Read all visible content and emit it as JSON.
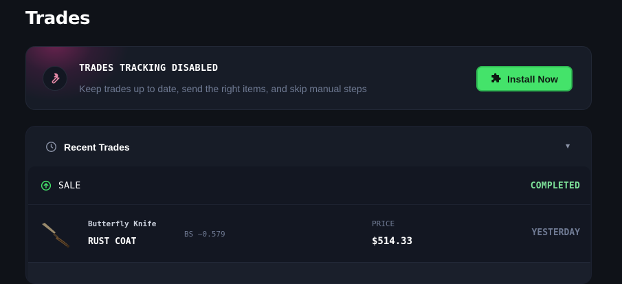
{
  "page": {
    "title": "Trades"
  },
  "banner": {
    "icon": "wrench-icon",
    "title": "TRADES TRACKING DISABLED",
    "description": "Keep trades up to date, send the right items, and skip manual steps",
    "button_label": "Install Now",
    "button_icon": "puzzle-icon",
    "accent": "#44e36a"
  },
  "recent_trades": {
    "title": "Recent Trades",
    "icon": "clock-icon",
    "trades": [
      {
        "type": "SALE",
        "type_icon": "arrow-up-circle-icon",
        "status": "COMPLETED",
        "status_color": "#7ee39a",
        "item_name": "Butterfly Knife",
        "item_skin": "RUST COAT",
        "item_float": "BS ~0.579",
        "price_label": "PRICE",
        "price": "$514.33",
        "time": "YESTERDAY"
      }
    ]
  }
}
